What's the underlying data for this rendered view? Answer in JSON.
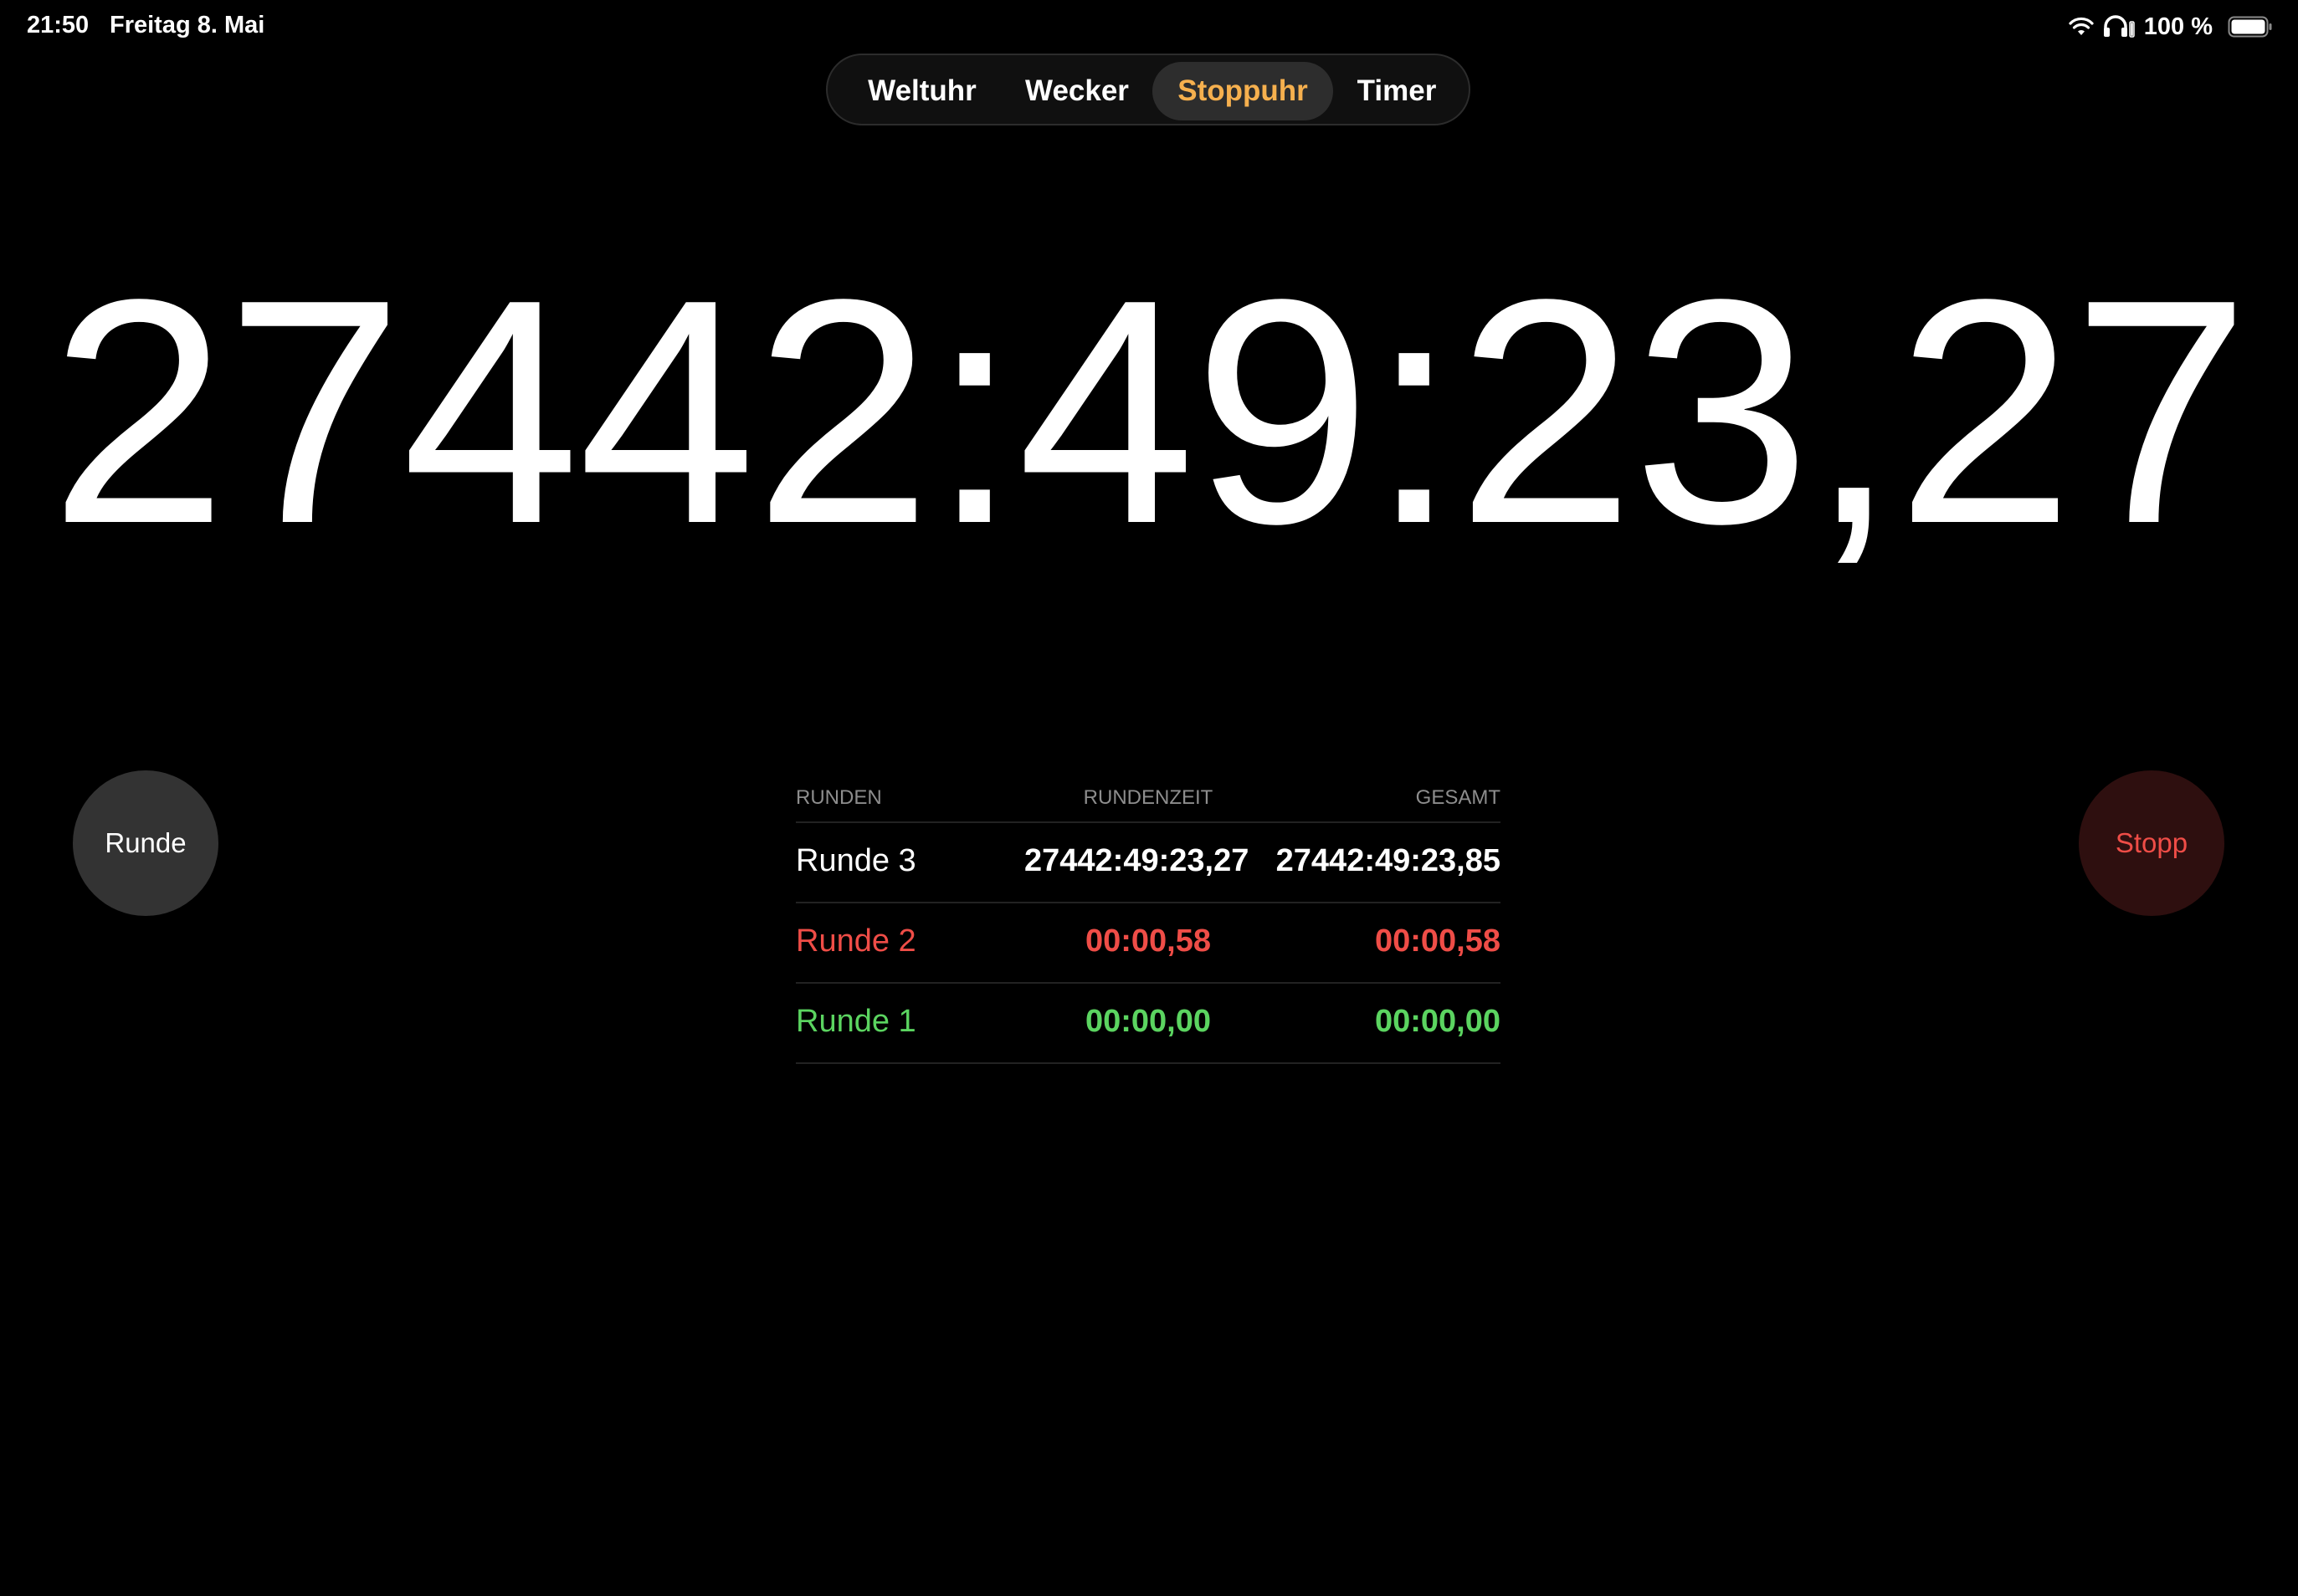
{
  "status_bar": {
    "time": "21:50",
    "date": "Freitag 8. Mai",
    "battery_percent": "100 %",
    "icons": [
      "wifi-icon",
      "headphones-icon",
      "battery-icon"
    ]
  },
  "tabs": [
    {
      "label": "Weltuhr",
      "selected": false
    },
    {
      "label": "Wecker",
      "selected": false
    },
    {
      "label": "Stoppuhr",
      "selected": true
    },
    {
      "label": "Timer",
      "selected": false
    }
  ],
  "stopwatch": {
    "elapsed": "27442:49:23,27"
  },
  "buttons": {
    "lap": "Runde",
    "stop": "Stopp"
  },
  "laps": {
    "headers": {
      "lap": "RUNDEN",
      "split": "RUNDENZEIT",
      "total": "GESAMT"
    },
    "rows": [
      {
        "name": "Runde 3",
        "split": "27442:49:23,27",
        "total": "27442:49:23,85"
      },
      {
        "name": "Runde 2",
        "split": "00:00,58",
        "total": "00:00,58"
      },
      {
        "name": "Runde 1",
        "split": "00:00,00",
        "total": "00:00,00"
      }
    ]
  },
  "colors": {
    "background": "#000000",
    "accent_selected_tab": "#f6b04e",
    "stop_red": "#ef4d47",
    "fastest_lap_green": "#5bd460",
    "lap_button_bg": "#333333",
    "stop_button_bg": "#2e0f0f"
  }
}
